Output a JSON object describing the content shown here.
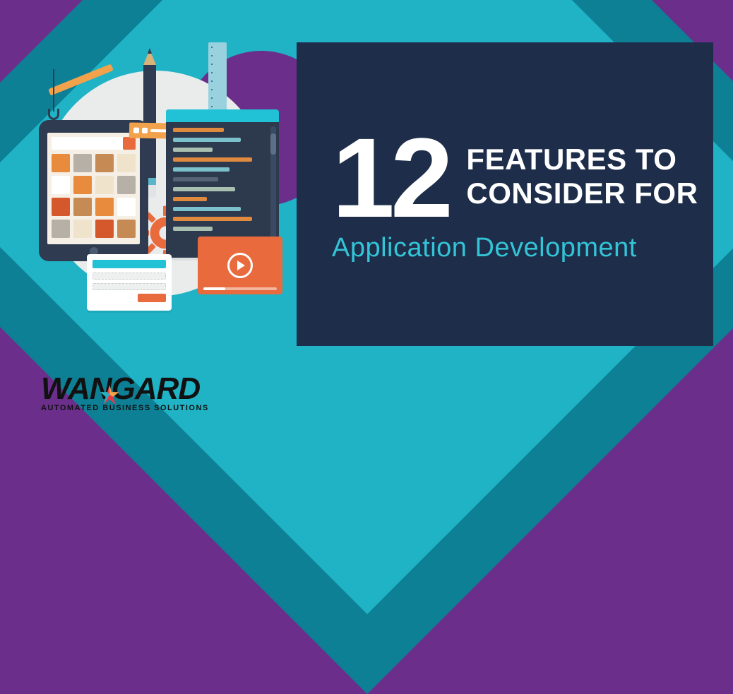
{
  "headline": {
    "number": "12",
    "line1": "FEATURES TO",
    "line2": "CONSIDER FOR",
    "sub": "Application Development"
  },
  "logo": {
    "name": "WANGARD",
    "tagline": "AUTOMATED BUSINESS SOLUTIONS"
  },
  "colors": {
    "purple": "#6b2e8a",
    "teal_dark": "#0d8096",
    "teal_light": "#1fb3c5",
    "navy": "#1d2d4a",
    "accent_teal": "#33c4d6",
    "orange": "#e86a3d"
  }
}
